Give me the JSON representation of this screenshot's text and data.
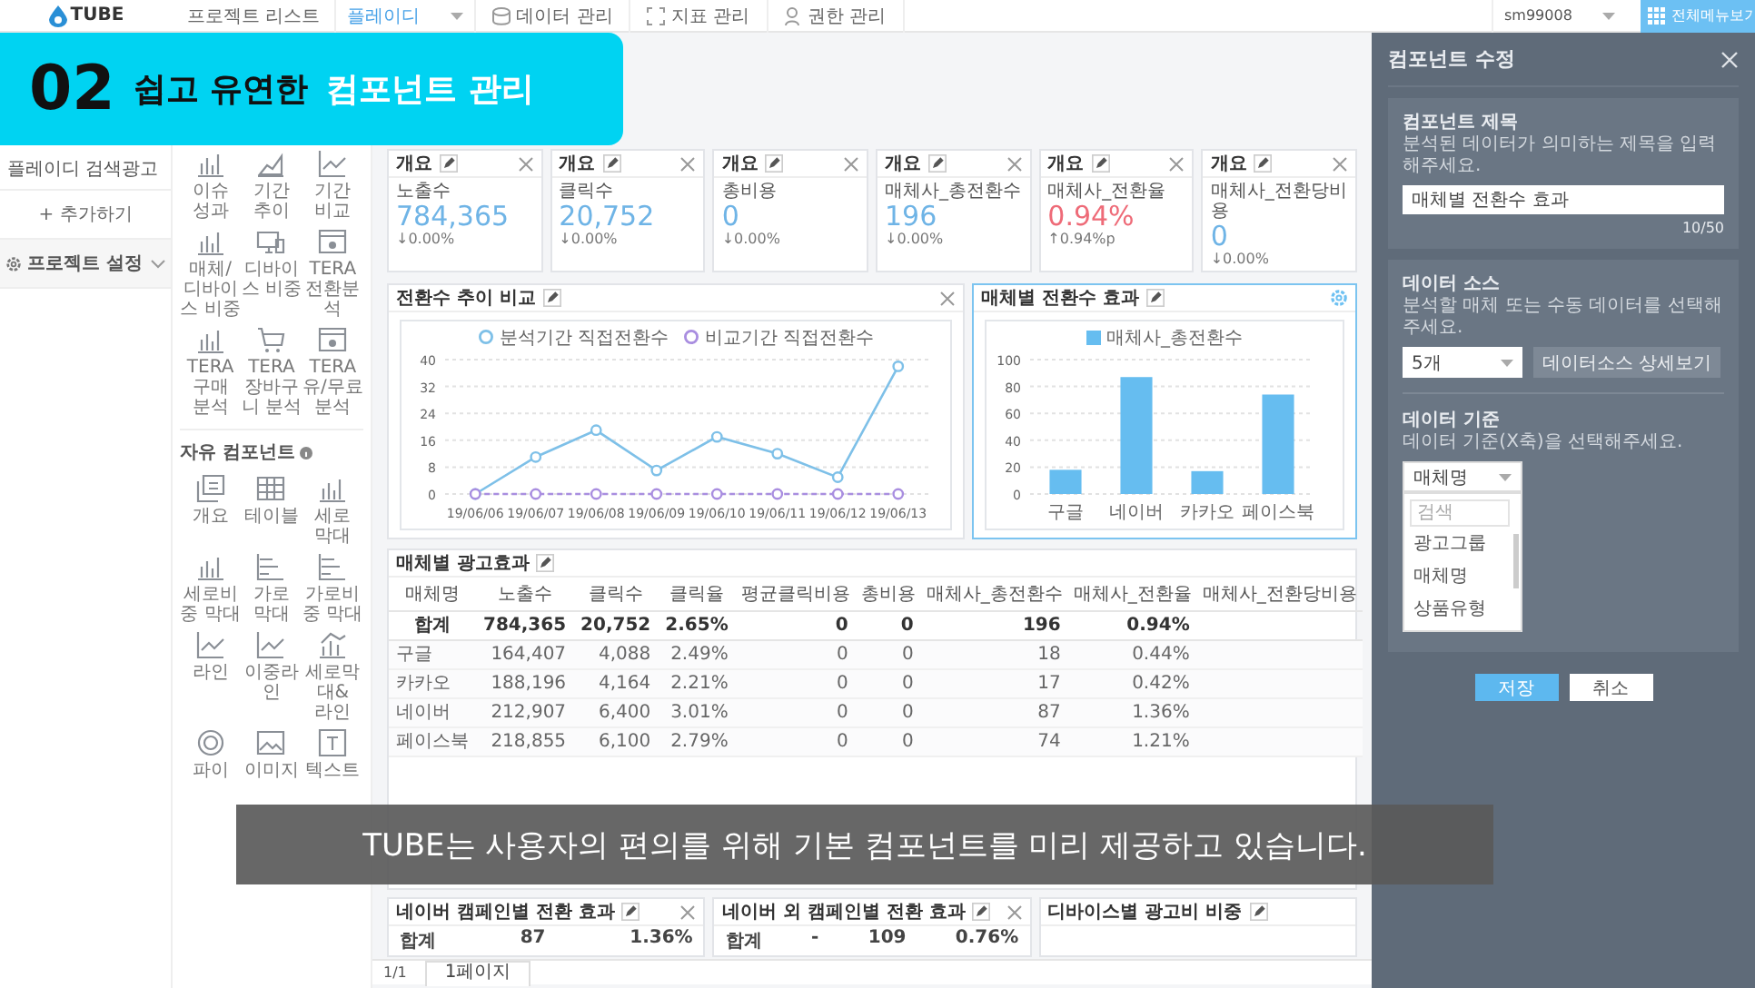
{
  "topbar": {
    "logo": "TUBE",
    "project_list": "프로젝트 리스트",
    "project_select": "플레이디",
    "menus": [
      {
        "label": "데이터 관리",
        "kind": "database"
      },
      {
        "label": "지표 관리",
        "kind": "frame"
      },
      {
        "label": "권한 관리",
        "kind": "user"
      }
    ],
    "account": "sm99008",
    "all_menu_button": "전체메뉴보기"
  },
  "sidebar": {
    "items": [
      {
        "label": "플레이디 검색광고",
        "kind": "project"
      },
      {
        "label": "+ 추가하기",
        "kind": "add"
      },
      {
        "label": "프로젝트 설정",
        "kind": "settings"
      }
    ]
  },
  "palette": {
    "preset_components": [
      {
        "label": "이슈 성과",
        "kind": "bar"
      },
      {
        "label": "기간 추이",
        "kind": "area"
      },
      {
        "label": "기간 비교",
        "kind": "line"
      },
      {
        "label": "매체/ 디바이스 비중",
        "kind": "bar"
      },
      {
        "label": "디바이스 비중",
        "kind": "device"
      },
      {
        "label": "TERA 전환분석",
        "kind": "browser"
      },
      {
        "label": "TERA 구매 분석",
        "kind": "bar"
      },
      {
        "label": "TERA 장바구니 분석",
        "kind": "cart"
      },
      {
        "label": "TERA 유/무료 분석",
        "kind": "browser"
      }
    ],
    "free_title": "자유 컴포넌트",
    "free_components": [
      {
        "label": "개요",
        "kind": "summary"
      },
      {
        "label": "테이블",
        "kind": "table"
      },
      {
        "label": "세로 막대",
        "kind": "bar"
      },
      {
        "label": "세로비중 막대",
        "kind": "bar"
      },
      {
        "label": "가로 막대",
        "kind": "hbar"
      },
      {
        "label": "가로비중 막대",
        "kind": "hbar"
      },
      {
        "label": "라인",
        "kind": "line"
      },
      {
        "label": "이중라인",
        "kind": "line"
      },
      {
        "label": "세로막대& 라인",
        "kind": "combo"
      },
      {
        "label": "파이",
        "kind": "pie"
      },
      {
        "label": "이미지",
        "kind": "image"
      },
      {
        "label": "텍스트",
        "kind": "text"
      }
    ]
  },
  "summary_cards": [
    {
      "header": "개요",
      "label": "노출수",
      "value": "784,365",
      "change": "↓0.00%",
      "color": "#6fb4e6"
    },
    {
      "header": "개요",
      "label": "클릭수",
      "value": "20,752",
      "change": "↓0.00%",
      "color": "#6fb4e6"
    },
    {
      "header": "개요",
      "label": "총비용",
      "value": "0",
      "change": "↓0.00%",
      "color": "#6fb4e6"
    },
    {
      "header": "개요",
      "label": "매체사_총전환수",
      "value": "196",
      "change": "↓0.00%",
      "color": "#6fb4e6"
    },
    {
      "header": "개요",
      "label": "매체사_전환율",
      "value": "0.94%",
      "change": "↑0.94%p",
      "color": "#ee6b78"
    },
    {
      "header": "개요",
      "label": "매체사_전환당비용",
      "value": "0",
      "change": "↓0.00%",
      "color": "#6fb4e6"
    }
  ],
  "charts": [
    {
      "title": "전환수 추이 비교",
      "selected": false,
      "closable": true,
      "chart_data": {
        "type": "line",
        "categories": [
          "19/06/06",
          "19/06/07",
          "19/06/08",
          "19/06/09",
          "19/06/10",
          "19/06/11",
          "19/06/12",
          "19/06/13"
        ],
        "ylim": [
          0,
          40
        ],
        "yticks": [
          0,
          8,
          16,
          24,
          32,
          40
        ],
        "grid": true,
        "legend": "top",
        "series": [
          {
            "name": "분석기간 직접전환수",
            "color": "#7ec0e8",
            "marker": "circle",
            "line_style": "solid",
            "values": [
              0,
              11,
              19,
              7,
              17,
              12,
              5,
              38
            ]
          },
          {
            "name": "비교기간 직접전환수",
            "color": "#a98ee0",
            "marker": "circle",
            "line_style": "dashed",
            "values": [
              0,
              0,
              0,
              0,
              0,
              0,
              0,
              0
            ]
          }
        ]
      }
    },
    {
      "title": "매체별 전환수 효과",
      "selected": true,
      "closable": false,
      "chart_data": {
        "type": "bar",
        "categories": [
          "구글",
          "네이버",
          "카카오",
          "페이스북"
        ],
        "ylim": [
          0,
          100
        ],
        "yticks": [
          0,
          20,
          40,
          60,
          80,
          100
        ],
        "grid": true,
        "legend": "top",
        "series": [
          {
            "name": "매체사_총전환수",
            "color": "#66bdf0",
            "values": [
              18,
              87,
              17,
              74
            ]
          }
        ]
      }
    }
  ],
  "table": {
    "title": "매체별 광고효과",
    "columns": [
      "매체명",
      "노출수",
      "클릭수",
      "클릭율",
      "평균클릭비용",
      "총비용",
      "매체사_총전환수",
      "매체사_전환율",
      "매체사_전환당비용"
    ],
    "rows": [
      {
        "kind": "total",
        "cells": [
          "합계",
          "784,365",
          "20,752",
          "2.65%",
          "0",
          "0",
          "196",
          "0.94%",
          ""
        ]
      },
      {
        "kind": "data",
        "cells": [
          "구글",
          "164,407",
          "4,088",
          "2.49%",
          "0",
          "0",
          "18",
          "0.44%",
          ""
        ]
      },
      {
        "kind": "data",
        "cells": [
          "카카오",
          "188,196",
          "4,164",
          "2.21%",
          "0",
          "0",
          "17",
          "0.42%",
          ""
        ]
      },
      {
        "kind": "data",
        "cells": [
          "네이버",
          "212,907",
          "6,400",
          "3.01%",
          "0",
          "0",
          "87",
          "1.36%",
          ""
        ]
      },
      {
        "kind": "data",
        "cells": [
          "페이스북",
          "218,855",
          "6,100",
          "2.79%",
          "0",
          "0",
          "74",
          "1.21%",
          ""
        ]
      }
    ]
  },
  "bottom_cards": [
    {
      "title": "네이버 캠페인별 전환 효과",
      "closable": true,
      "rows": [
        [
          "합계",
          "87",
          "1.36%"
        ]
      ]
    },
    {
      "title": "네이버 외 캠페인별 전환 효과",
      "closable": true,
      "rows": [
        [
          "합계",
          "-",
          "109",
          "0.76%"
        ]
      ]
    },
    {
      "title": "디바이스별 광고비 비중",
      "closable": false
    }
  ],
  "pagination": {
    "info": "1/1",
    "tabs": [
      {
        "label": "1페이지",
        "selected": true
      }
    ]
  },
  "edit_panel": {
    "title": "컴포넌트 수정",
    "title_section": {
      "label": "컴포넌트 제목",
      "help": "분석된 데이터가 의미하는 제목을 입력해주세요.",
      "value": "매체별 전환수 효과",
      "counter": "10/50"
    },
    "source_section": {
      "label": "데이터 소스",
      "help": "분석할 매체 또는 수동 데이터를 선택해주세요.",
      "select": "5개",
      "detail_button": "데이터소스 상세보기"
    },
    "basis_section": {
      "label": "데이터 기준",
      "help": "데이터 기준(X축)을 선택해주세요.",
      "select": "매체명",
      "dropdown": {
        "search_placeholder": "검색",
        "options": [
          "광고그룹",
          "매체명",
          "상품유형"
        ]
      }
    },
    "buttons": [
      {
        "label": "저장",
        "kind": "primary"
      },
      {
        "label": "취소",
        "kind": "secondary"
      }
    ]
  },
  "overlays": {
    "banner": {
      "number": "02",
      "lead": "쉽고 유연한",
      "highlight": "컴포넌트 관리"
    },
    "caption": "TUBE는 사용자의 편의를 위해 기본 컴포넌트를 미리 제공하고 있습니다."
  }
}
